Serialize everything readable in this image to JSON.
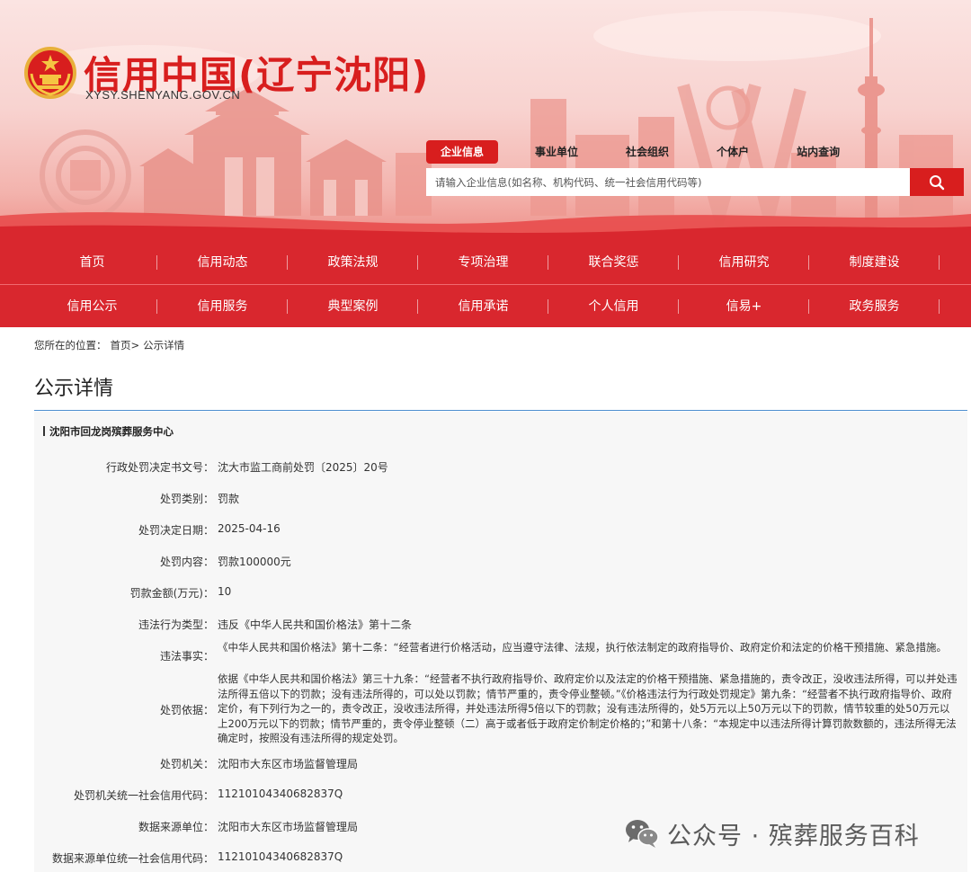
{
  "header": {
    "site_title": "信用中国(辽宁沈阳)",
    "site_domain": "XYSY.SHENYANG.GOV.CN",
    "emblem_icon": "national-emblem-icon",
    "search_tabs": [
      "企业信息",
      "事业单位",
      "社会组织",
      "个体户",
      "站内查询"
    ],
    "active_tab": "企业信息",
    "search_placeholder": "请输入企业信息(如名称、机构代码、统一社会信用代码等)",
    "search_icon": "search-icon"
  },
  "nav": {
    "row1": [
      "首页",
      "信用动态",
      "政策法规",
      "专项治理",
      "联合奖惩",
      "信用研究",
      "制度建设"
    ],
    "row2": [
      "信用公示",
      "信用服务",
      "典型案例",
      "信用承诺",
      "个人信用",
      "信易+",
      "政务服务"
    ]
  },
  "breadcrumb": {
    "prefix": "您所在的位置：",
    "home": "首页>",
    "current": "公示详情"
  },
  "page_title": "公示详情",
  "detail": {
    "entity_name": "沈阳市回龙岗殡葬服务中心",
    "rows": [
      {
        "label": "行政处罚决定书文号：",
        "value": "沈大市监工商前处罚〔2025〕20号"
      },
      {
        "label": "处罚类别：",
        "value": "罚款"
      },
      {
        "label": "处罚决定日期：",
        "value": "2025-04-16"
      },
      {
        "label": "处罚内容：",
        "value": "罚款100000元"
      },
      {
        "label": "罚款金额(万元)：",
        "value": "10"
      },
      {
        "label": "违法行为类型：",
        "value": "违反《中华人民共和国价格法》第十二条"
      }
    ],
    "facts_label": "违法事实：",
    "facts_value": "《中华人民共和国价格法》第十二条：“经营者进行价格活动，应当遵守法律、法规，执行依法制定的政府指导价、政府定价和法定的价格干预措施、紧急措施。",
    "basis_label": "处罚依据：",
    "basis_value": "依据《中华人民共和国价格法》第三十九条：“经营者不执行政府指导价、政府定价以及法定的价格干预措施、紧急措施的，责令改正，没收违法所得，可以并处违法所得五倍以下的罚款；没有违法所得的，可以处以罚款；情节严重的，责令停业整顿。”《价格违法行为行政处罚规定》第九条：“经营者不执行政府指导价、政府定价，有下列行为之一的，责令改正，没收违法所得，并处违法所得5倍以下的罚款；没有违法所得的，处5万元以上50万元以下的罚款，情节较重的处50万元以上200万元以下的罚款；情节严重的，责令停业整顿（二）高于或者低于政府定价制定价格的；”和第十八条：“本规定中以违法所得计算罚款数额的，违法所得无法确定时，按照没有违法所得的规定处罚。",
    "rows_after": [
      {
        "label": "处罚机关：",
        "value": "沈阳市大东区市场监督管理局"
      },
      {
        "label": "处罚机关统一社会信用代码：",
        "value": "11210104340682837Q"
      },
      {
        "label": "数据来源单位：",
        "value": "沈阳市大东区市场监督管理局"
      },
      {
        "label": "数据来源单位统一社会信用代码：",
        "value": "11210104340682837Q"
      }
    ]
  },
  "watermark": {
    "text": "公众号 · 殡葬服务百科",
    "icon": "wechat-icon"
  },
  "colors": {
    "brand_red": "#d81e1e",
    "nav_red": "#d9272e",
    "rule_blue": "#4f8fcf"
  }
}
